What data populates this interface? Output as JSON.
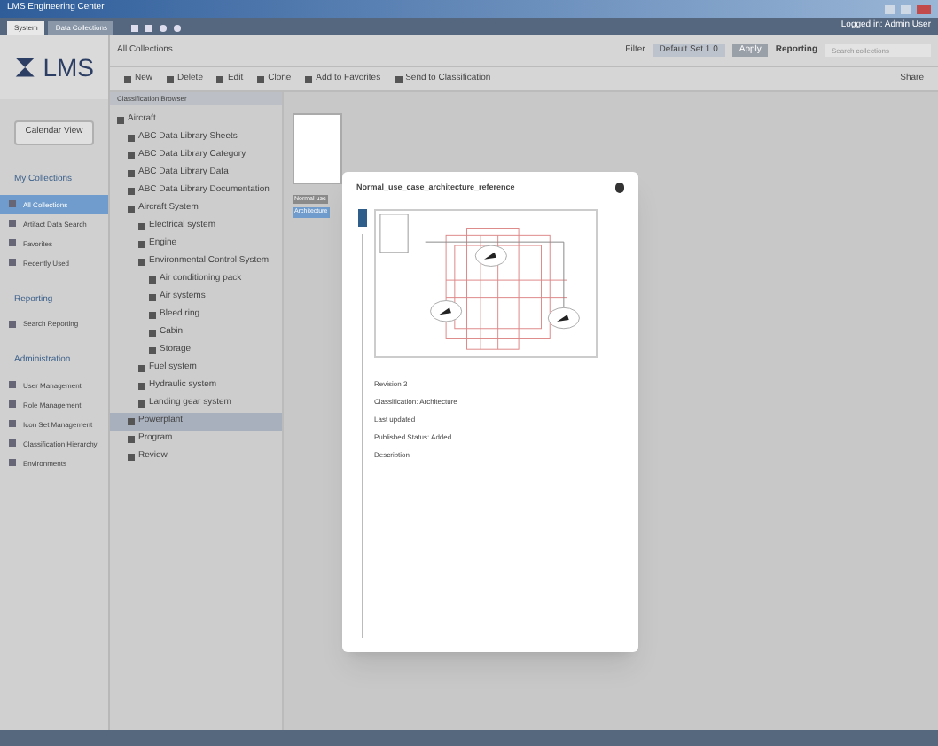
{
  "window": {
    "title": "LMS Engineering Center"
  },
  "tabs": [
    {
      "label": "System",
      "selected": true
    },
    {
      "label": "Data Collections",
      "selected": false
    }
  ],
  "logo": "LMS",
  "header": {
    "breadcrumb": "All Collections",
    "filter_label": "Filter",
    "filter_value": "Default Set 1.0",
    "apply": "Apply",
    "reporting": "Reporting",
    "search_placeholder": "Search collections",
    "user": "Logged in: Admin User"
  },
  "toolbar": {
    "items": [
      "New",
      "Delete",
      "Edit",
      "Clone",
      "Add to Favorites",
      "Send to Classification"
    ],
    "right": "Share"
  },
  "sidebar": {
    "button": "Calendar View",
    "sections": [
      {
        "title": "My Collections",
        "items": [
          {
            "label": "All Collections",
            "selected": true
          },
          {
            "label": "Artifact Data Search",
            "selected": false
          },
          {
            "label": "Favorites",
            "selected": false
          },
          {
            "label": "Recently Used",
            "selected": false
          }
        ]
      },
      {
        "title": "Reporting",
        "items": [
          {
            "label": "Search Reporting",
            "selected": false
          }
        ]
      },
      {
        "title": "Administration",
        "items": [
          {
            "label": "User Management",
            "selected": false
          },
          {
            "label": "Role Management",
            "selected": false
          },
          {
            "label": "Icon Set Management",
            "selected": false
          },
          {
            "label": "Classification Hierarchy",
            "selected": false
          },
          {
            "label": "Environments",
            "selected": false
          }
        ]
      }
    ]
  },
  "tree": {
    "title": "Classification Browser",
    "nodes": [
      {
        "label": "Aircraft",
        "selected": false,
        "children": [
          {
            "label": "ABC Data Library Sheets",
            "selected": false
          },
          {
            "label": "ABC Data Library Category",
            "selected": false
          },
          {
            "label": "ABC Data Library Data",
            "selected": false
          },
          {
            "label": "ABC Data Library Documentation",
            "selected": false
          },
          {
            "label": "Aircraft System",
            "selected": false,
            "children": [
              {
                "label": "Electrical system",
                "selected": false
              },
              {
                "label": "Engine",
                "selected": false
              },
              {
                "label": "Environmental Control System",
                "selected": false,
                "children": [
                  {
                    "label": "Air conditioning pack",
                    "selected": false
                  },
                  {
                    "label": "Air systems",
                    "selected": false
                  },
                  {
                    "label": "Bleed ring",
                    "selected": false
                  },
                  {
                    "label": "Cabin",
                    "selected": false
                  },
                  {
                    "label": "Storage",
                    "selected": false
                  }
                ]
              },
              {
                "label": "Fuel system",
                "selected": false
              },
              {
                "label": "Hydraulic system",
                "selected": false
              },
              {
                "label": "Landing gear system",
                "selected": false
              }
            ]
          },
          {
            "label": "Powerplant",
            "selected": true
          },
          {
            "label": "Program",
            "selected": false
          },
          {
            "label": "Review",
            "selected": false
          }
        ]
      }
    ]
  },
  "cards": [
    {
      "label": "Normal use",
      "selected": false
    },
    {
      "label": "Architecture",
      "selected": true
    }
  ],
  "dialog": {
    "title": "Normal_use_case_architecture_reference",
    "details": [
      "Revision 3",
      "Classification: Architecture",
      "Last updated",
      "Published Status: Added",
      "Description"
    ]
  }
}
